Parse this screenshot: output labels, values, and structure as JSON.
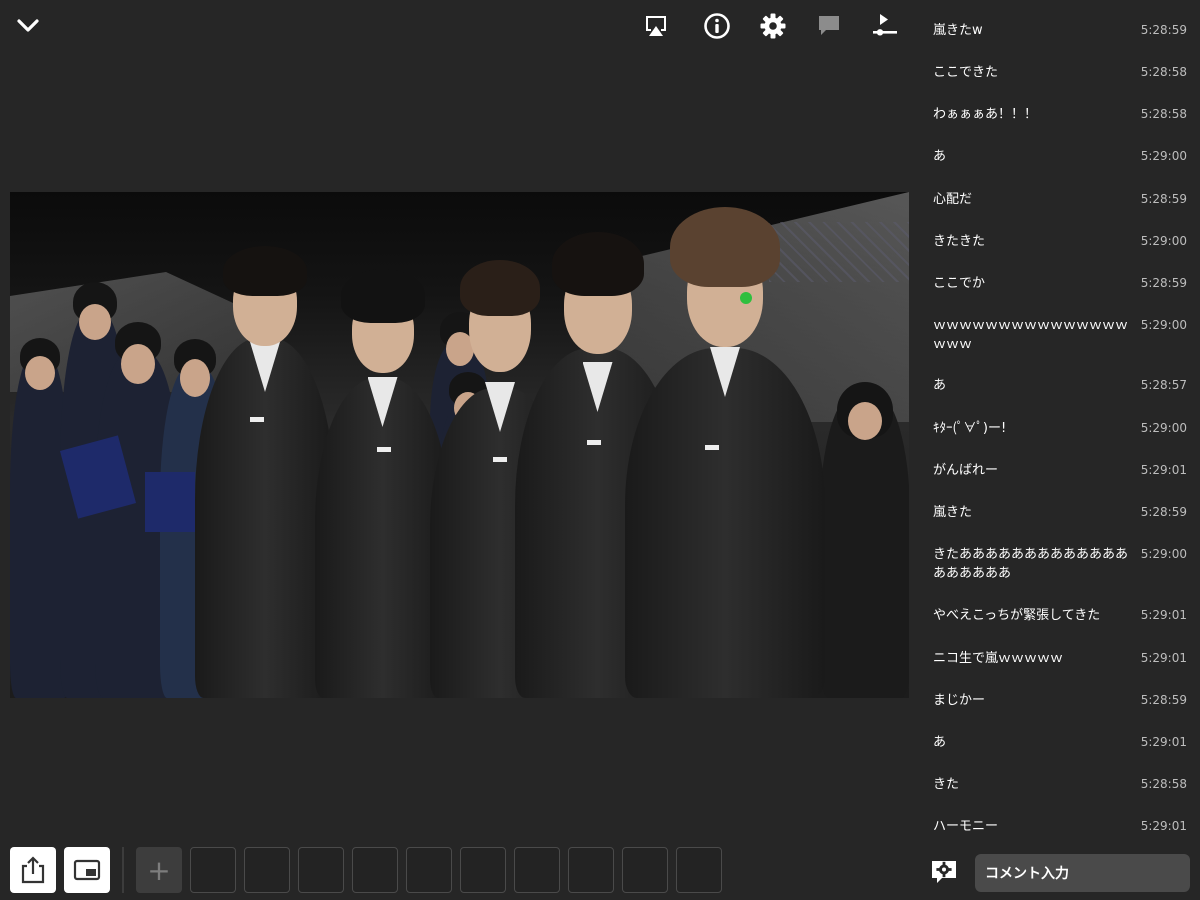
{
  "top_bar": {
    "icons": [
      "chevron-down-icon",
      "airplay-icon",
      "info-icon",
      "gear-icon",
      "comment-bubble-icon",
      "playlist-icon"
    ]
  },
  "video": {
    "description_icon": "live-video"
  },
  "bottom_toolbar": {
    "add_label": "+",
    "empty_slots": 10
  },
  "comments": [
    {
      "text": "嵐きたw",
      "time": "5:28:59"
    },
    {
      "text": "ここできた",
      "time": "5:28:58"
    },
    {
      "text": "わぁぁぁあ！！！",
      "time": "5:28:58"
    },
    {
      "text": "あ",
      "time": "5:29:00"
    },
    {
      "text": "心配だ",
      "time": "5:28:59"
    },
    {
      "text": "きたきた",
      "time": "5:29:00"
    },
    {
      "text": "ここでか",
      "time": "5:28:59"
    },
    {
      "text": "ｗｗｗｗｗｗｗｗｗｗｗｗｗｗｗｗｗｗ",
      "time": "5:29:00"
    },
    {
      "text": "あ",
      "time": "5:28:57"
    },
    {
      "text": "ｷﾀｰ(ﾟ∀ﾟ)ー!",
      "time": "5:29:00"
    },
    {
      "text": "がんばれー",
      "time": "5:29:01"
    },
    {
      "text": "嵐きた",
      "time": "5:28:59"
    },
    {
      "text": "きたあああああああああああああああああああ",
      "time": "5:29:00"
    },
    {
      "text": "やべえこっちが緊張してきた",
      "time": "5:29:01"
    },
    {
      "text": "ニコ生で嵐ｗｗｗｗｗ",
      "time": "5:29:01"
    },
    {
      "text": "まじかー",
      "time": "5:28:59"
    },
    {
      "text": "あ",
      "time": "5:29:01"
    },
    {
      "text": "きた",
      "time": "5:28:58"
    },
    {
      "text": "ハーモニー",
      "time": "5:29:01"
    }
  ],
  "comment_input": {
    "placeholder": "コメント入力"
  },
  "colors": {
    "background": "#262626",
    "input_bg": "#4a4a4a",
    "time_text": "#bdbdbd"
  }
}
